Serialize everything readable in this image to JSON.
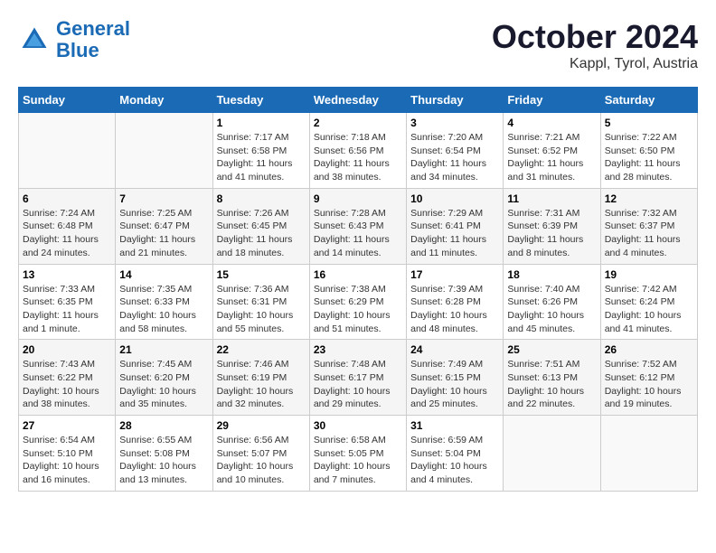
{
  "header": {
    "logo_line1": "General",
    "logo_line2": "Blue",
    "title": "October 2024",
    "subtitle": "Kappl, Tyrol, Austria"
  },
  "weekdays": [
    "Sunday",
    "Monday",
    "Tuesday",
    "Wednesday",
    "Thursday",
    "Friday",
    "Saturday"
  ],
  "weeks": [
    [
      {
        "day": "",
        "info": ""
      },
      {
        "day": "",
        "info": ""
      },
      {
        "day": "1",
        "info": "Sunrise: 7:17 AM\nSunset: 6:58 PM\nDaylight: 11 hours and 41 minutes."
      },
      {
        "day": "2",
        "info": "Sunrise: 7:18 AM\nSunset: 6:56 PM\nDaylight: 11 hours and 38 minutes."
      },
      {
        "day": "3",
        "info": "Sunrise: 7:20 AM\nSunset: 6:54 PM\nDaylight: 11 hours and 34 minutes."
      },
      {
        "day": "4",
        "info": "Sunrise: 7:21 AM\nSunset: 6:52 PM\nDaylight: 11 hours and 31 minutes."
      },
      {
        "day": "5",
        "info": "Sunrise: 7:22 AM\nSunset: 6:50 PM\nDaylight: 11 hours and 28 minutes."
      }
    ],
    [
      {
        "day": "6",
        "info": "Sunrise: 7:24 AM\nSunset: 6:48 PM\nDaylight: 11 hours and 24 minutes."
      },
      {
        "day": "7",
        "info": "Sunrise: 7:25 AM\nSunset: 6:47 PM\nDaylight: 11 hours and 21 minutes."
      },
      {
        "day": "8",
        "info": "Sunrise: 7:26 AM\nSunset: 6:45 PM\nDaylight: 11 hours and 18 minutes."
      },
      {
        "day": "9",
        "info": "Sunrise: 7:28 AM\nSunset: 6:43 PM\nDaylight: 11 hours and 14 minutes."
      },
      {
        "day": "10",
        "info": "Sunrise: 7:29 AM\nSunset: 6:41 PM\nDaylight: 11 hours and 11 minutes."
      },
      {
        "day": "11",
        "info": "Sunrise: 7:31 AM\nSunset: 6:39 PM\nDaylight: 11 hours and 8 minutes."
      },
      {
        "day": "12",
        "info": "Sunrise: 7:32 AM\nSunset: 6:37 PM\nDaylight: 11 hours and 4 minutes."
      }
    ],
    [
      {
        "day": "13",
        "info": "Sunrise: 7:33 AM\nSunset: 6:35 PM\nDaylight: 11 hours and 1 minute."
      },
      {
        "day": "14",
        "info": "Sunrise: 7:35 AM\nSunset: 6:33 PM\nDaylight: 10 hours and 58 minutes."
      },
      {
        "day": "15",
        "info": "Sunrise: 7:36 AM\nSunset: 6:31 PM\nDaylight: 10 hours and 55 minutes."
      },
      {
        "day": "16",
        "info": "Sunrise: 7:38 AM\nSunset: 6:29 PM\nDaylight: 10 hours and 51 minutes."
      },
      {
        "day": "17",
        "info": "Sunrise: 7:39 AM\nSunset: 6:28 PM\nDaylight: 10 hours and 48 minutes."
      },
      {
        "day": "18",
        "info": "Sunrise: 7:40 AM\nSunset: 6:26 PM\nDaylight: 10 hours and 45 minutes."
      },
      {
        "day": "19",
        "info": "Sunrise: 7:42 AM\nSunset: 6:24 PM\nDaylight: 10 hours and 41 minutes."
      }
    ],
    [
      {
        "day": "20",
        "info": "Sunrise: 7:43 AM\nSunset: 6:22 PM\nDaylight: 10 hours and 38 minutes."
      },
      {
        "day": "21",
        "info": "Sunrise: 7:45 AM\nSunset: 6:20 PM\nDaylight: 10 hours and 35 minutes."
      },
      {
        "day": "22",
        "info": "Sunrise: 7:46 AM\nSunset: 6:19 PM\nDaylight: 10 hours and 32 minutes."
      },
      {
        "day": "23",
        "info": "Sunrise: 7:48 AM\nSunset: 6:17 PM\nDaylight: 10 hours and 29 minutes."
      },
      {
        "day": "24",
        "info": "Sunrise: 7:49 AM\nSunset: 6:15 PM\nDaylight: 10 hours and 25 minutes."
      },
      {
        "day": "25",
        "info": "Sunrise: 7:51 AM\nSunset: 6:13 PM\nDaylight: 10 hours and 22 minutes."
      },
      {
        "day": "26",
        "info": "Sunrise: 7:52 AM\nSunset: 6:12 PM\nDaylight: 10 hours and 19 minutes."
      }
    ],
    [
      {
        "day": "27",
        "info": "Sunrise: 6:54 AM\nSunset: 5:10 PM\nDaylight: 10 hours and 16 minutes."
      },
      {
        "day": "28",
        "info": "Sunrise: 6:55 AM\nSunset: 5:08 PM\nDaylight: 10 hours and 13 minutes."
      },
      {
        "day": "29",
        "info": "Sunrise: 6:56 AM\nSunset: 5:07 PM\nDaylight: 10 hours and 10 minutes."
      },
      {
        "day": "30",
        "info": "Sunrise: 6:58 AM\nSunset: 5:05 PM\nDaylight: 10 hours and 7 minutes."
      },
      {
        "day": "31",
        "info": "Sunrise: 6:59 AM\nSunset: 5:04 PM\nDaylight: 10 hours and 4 minutes."
      },
      {
        "day": "",
        "info": ""
      },
      {
        "day": "",
        "info": ""
      }
    ]
  ]
}
